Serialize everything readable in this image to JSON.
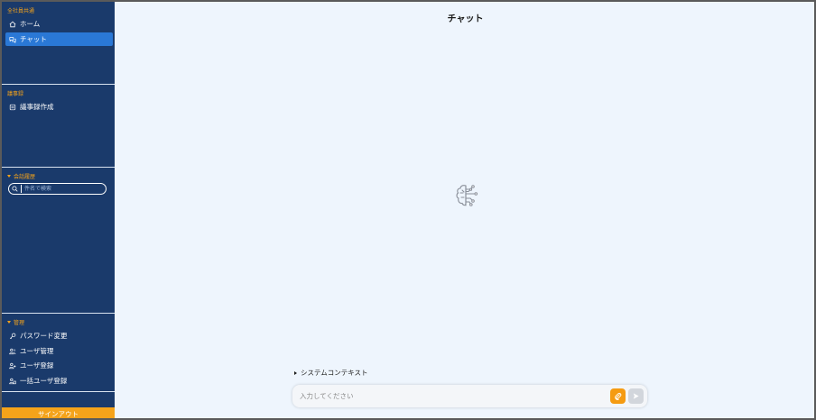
{
  "sidebar": {
    "section_common": "全社員共通",
    "home_label": "ホーム",
    "chat_label": "チャット",
    "section_minutes": "議事録",
    "minutes_create_label": "議事録作成",
    "section_history": "会話履歴",
    "history_search_placeholder": "件名で検索",
    "section_admin": "管理",
    "admin_items": [
      "パスワード変更",
      "ユーザ管理",
      "ユーザ登録",
      "一括ユーザ登録"
    ],
    "signout_label": "サインアウト"
  },
  "main": {
    "title": "チャット",
    "system_context_label": "システムコンテキスト",
    "input_placeholder": "入力してください"
  },
  "colors": {
    "sidebar_bg": "#1a3a6b",
    "accent_orange": "#f5a31a",
    "active_blue": "#2a78d6",
    "main_bg": "#eef5fd"
  },
  "icons": {
    "home": "home-icon",
    "chat": "chat-bubbles-icon",
    "minutes": "document-icon",
    "search": "search-icon",
    "password": "key-icon",
    "user_manage": "user-group-icon",
    "user_register": "user-plus-icon",
    "bulk_register": "user-upload-icon",
    "brain": "brain-circuit-icon",
    "attach": "paperclip-icon",
    "send": "send-icon"
  }
}
